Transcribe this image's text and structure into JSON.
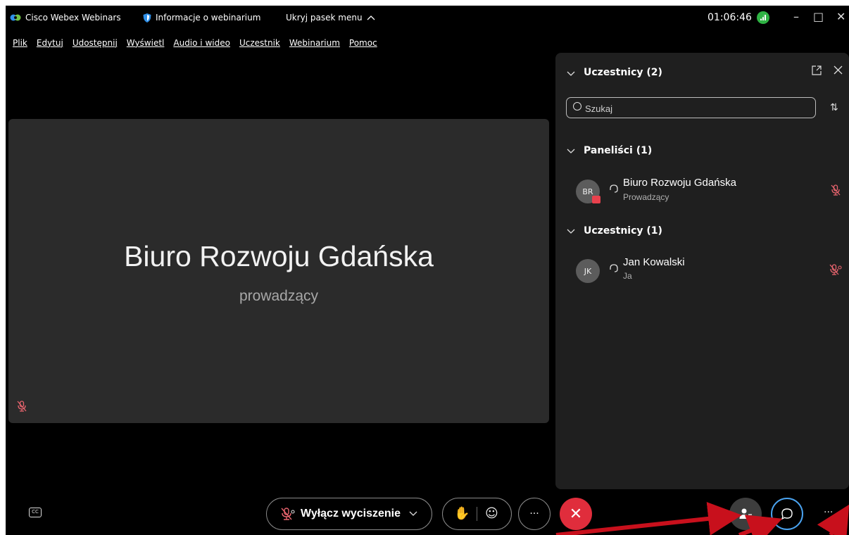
{
  "titlebar": {
    "app_name": "Cisco Webex Webinars",
    "info": "Informacje o webinarium",
    "hide_menu": "Ukryj pasek menu",
    "clock": "01:06:46",
    "minimize": "–",
    "maximize": "□",
    "close": "✕"
  },
  "menu": [
    "Plik",
    "Edytuj",
    "Udostępnij",
    "Wyświetl",
    "Audio i wideo",
    "Uczestnik",
    "Webinarium",
    "Pomoc"
  ],
  "stage": {
    "name": "Biuro Rozwoju Gdańska",
    "role": "prowadzący"
  },
  "panel": {
    "title": "Uczestnicy (2)",
    "search_placeholder": "Szukaj",
    "sections": [
      {
        "title": "Paneliści (1)",
        "people": [
          {
            "initials": "BR",
            "name": "Biuro Rozwoju Gdańska",
            "role": "Prowadzący"
          }
        ]
      },
      {
        "title": "Uczestnicy (1)",
        "people": [
          {
            "initials": "JK",
            "name": "Jan Kowalski",
            "role": "Ja"
          }
        ]
      }
    ]
  },
  "bottombar": {
    "unmute_label": "Wyłącz wyciszenie",
    "more": "···",
    "end": "✕"
  },
  "colors": {
    "accent_blue": "#4aa3f0",
    "end_red": "#e02d3c",
    "mute_red": "#e8646e",
    "network_green": "#2fb344"
  },
  "icons": [
    "webex-logo-icon",
    "shield-icon",
    "chevron-up-icon",
    "network-icon",
    "chevron-down-icon",
    "popout-icon",
    "close-icon",
    "search-icon",
    "sort-icon",
    "headset-icon",
    "muted-mic-icon",
    "cc-icon",
    "hand-icon",
    "reaction-icon",
    "people-icon",
    "chat-icon"
  ]
}
